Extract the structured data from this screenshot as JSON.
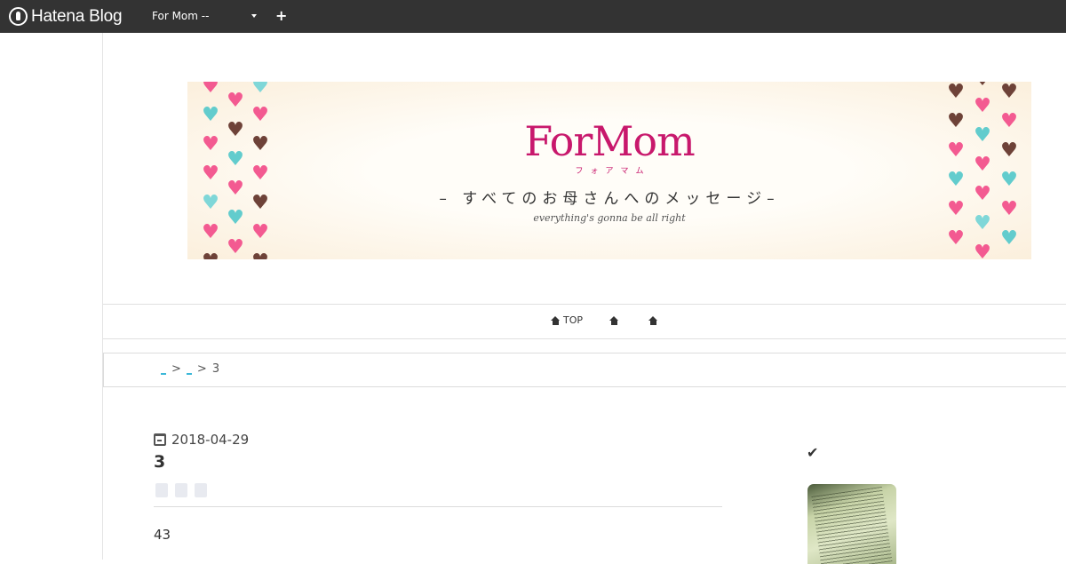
{
  "topbar": {
    "brand": "Hatena Blog",
    "blog_selector": "For Mom --",
    "add_label": "+"
  },
  "banner": {
    "title": "ForMom",
    "kana": "フォアマム",
    "subtitle": "– すべてのお母さんへのメッセージ–",
    "tagline": "everything's gonna be all right"
  },
  "nav": {
    "items": [
      {
        "label": "TOP",
        "icon": "home-icon"
      },
      {
        "label": "",
        "icon": "home-icon"
      },
      {
        "label": "",
        "icon": "home-icon"
      }
    ]
  },
  "breadcrumb": {
    "current": "3",
    "separator": ">"
  },
  "entry": {
    "date": "2018-04-29",
    "title": "3",
    "body": "43"
  },
  "sidebar": {
    "check_icon": "check-icon"
  },
  "colors": {
    "topbar": "#333333",
    "brand_pink": "#c8186c",
    "heart_pink": "#f35a91",
    "heart_teal": "#62cccd",
    "heart_brown": "#6e4238",
    "link": "#3cb8d8"
  }
}
